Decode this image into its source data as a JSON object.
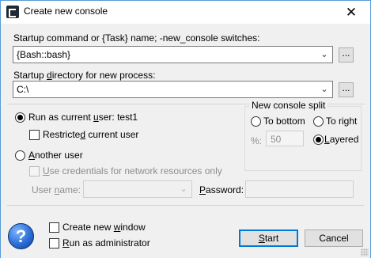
{
  "window": {
    "title": "Create new console",
    "close_symbol": "✕"
  },
  "startup_command": {
    "label": "Startup command or {Task} name; -new_console switches:",
    "value": "{Bash::bash}",
    "browse_label": "..."
  },
  "startup_directory": {
    "label_pre": "Startup ",
    "label_u": "d",
    "label_post": "irectory for new process:",
    "value": "C:\\",
    "browse_label": "..."
  },
  "run_as_current": {
    "label_pre": "Run as current ",
    "label_u": "u",
    "label_post": "ser: test1",
    "selected": true
  },
  "restricted_user": {
    "label_pre": "Restricte",
    "label_u": "d",
    "label_post": " current user",
    "checked": false
  },
  "another_user": {
    "label_pre": "",
    "label_u": "A",
    "label_post": "nother user",
    "selected": false
  },
  "use_credentials": {
    "label_pre": "",
    "label_u": "U",
    "label_post": "se credentials for network resources only",
    "checked": false
  },
  "user_name": {
    "label_pre": "User ",
    "label_u": "n",
    "label_post": "ame:",
    "value": ""
  },
  "password": {
    "label_pre": "",
    "label_u": "P",
    "label_post": "assword:",
    "value": ""
  },
  "split": {
    "title": "New console split",
    "to_bottom": "To bottom",
    "to_right": "To right",
    "percent_label": "%:",
    "percent_value": "50",
    "layered": "Layered",
    "selected": "layered"
  },
  "create_new_window": {
    "label_pre": "Create new ",
    "label_u": "w",
    "label_post": "indow",
    "checked": false
  },
  "run_as_admin": {
    "label_pre": "",
    "label_u": "R",
    "label_post": "un as administrator",
    "checked": false
  },
  "buttons": {
    "start_pre": "",
    "start_u": "S",
    "start_post": "tart",
    "cancel": "Cancel"
  },
  "help_symbol": "?"
}
